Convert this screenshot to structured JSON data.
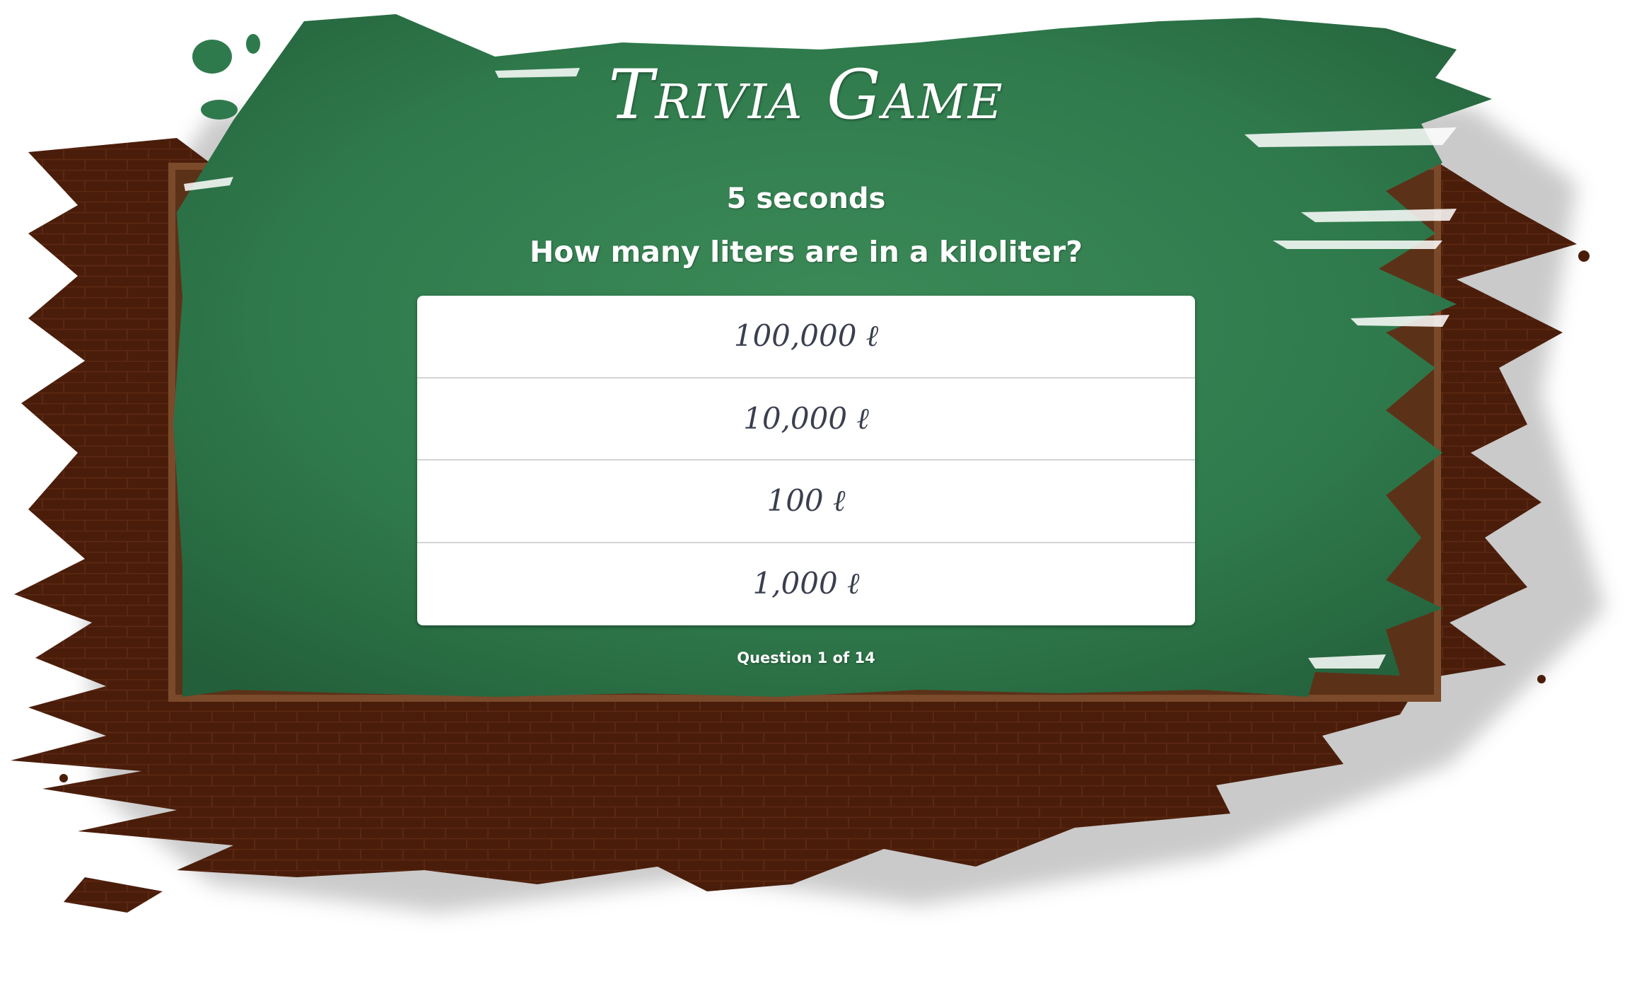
{
  "game": {
    "title": "Trivia Game",
    "timer": "5 seconds",
    "question": "How many liters are in a kiloliter?",
    "answers": [
      {
        "label": "100,000 ℓ"
      },
      {
        "label": "10,000 ℓ"
      },
      {
        "label": "100 ℓ"
      },
      {
        "label": "1,000 ℓ"
      }
    ],
    "progress": "Question 1 of 14"
  },
  "colors": {
    "board_green": "#2f7a4c",
    "brick_brown": "#4a1d0b",
    "frame_wood": "#7b4a2a",
    "answer_text": "#3a3f4f"
  }
}
